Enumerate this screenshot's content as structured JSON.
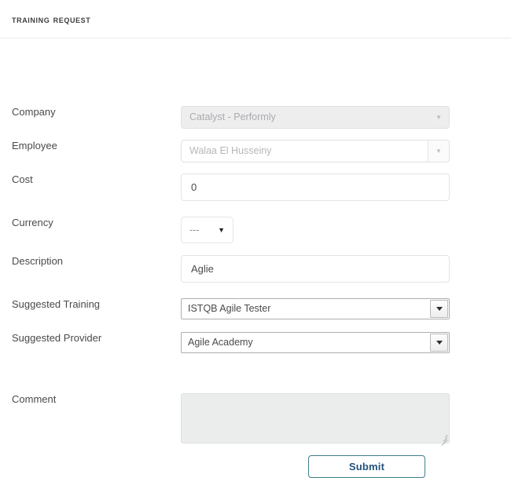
{
  "header": {
    "title": "TRAINING REQUEST"
  },
  "form": {
    "fields": [
      {
        "label": "Company",
        "value": "Catalyst - Performly",
        "state": "disabled",
        "control": "select2"
      },
      {
        "label": "Employee",
        "value": "Walaa El Husseiny",
        "state": "placeholder",
        "control": "select2-button"
      },
      {
        "label": "Cost",
        "value": "0",
        "state": "enabled",
        "control": "text-input"
      },
      {
        "label": "Currency",
        "value": "---",
        "state": "enabled",
        "control": "select-small"
      },
      {
        "label": "Description",
        "value": "Aglie",
        "state": "enabled",
        "control": "text-input"
      },
      {
        "label": "Suggested Training",
        "value": "ISTQB Agile Tester",
        "state": "enabled",
        "control": "native-select"
      },
      {
        "label": "Suggested Provider",
        "value": "Agile Academy",
        "state": "enabled",
        "control": "native-select"
      },
      {
        "label": "Comment",
        "value": "",
        "state": "disabled",
        "control": "textarea"
      }
    ]
  },
  "actions": {
    "submit_label": "Submit"
  },
  "icons": {
    "caret_small": "▼",
    "caret_employee": "▼"
  },
  "colors": {
    "submit_border": "#3f7f8a",
    "submit_text": "#23527c",
    "label_text": "#4a4a4a",
    "disabled_fill": "#ebecec"
  }
}
